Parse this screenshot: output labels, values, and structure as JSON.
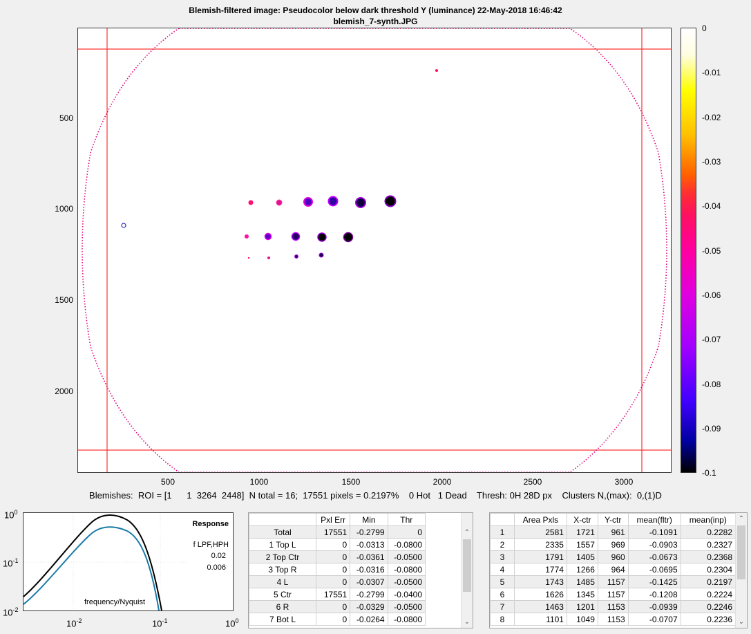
{
  "header": {
    "title_line1": "Blemish-filtered image:  Pseudocolor    below dark threshold    Y (luminance)   22-May-2018 16:46:42",
    "title_line2": "blemish_7-synth.JPG"
  },
  "main_plot": {
    "y_ticks": [
      "500",
      "1000",
      "1500",
      "2000"
    ],
    "x_ticks": [
      "500",
      "1000",
      "1500",
      "2000",
      "2500",
      "3000"
    ]
  },
  "colorbar": {
    "ticks": [
      "0",
      "-0.01",
      "-0.02",
      "-0.03",
      "-0.04",
      "-0.05",
      "-0.06",
      "-0.07",
      "-0.08",
      "-0.09",
      "-0.1"
    ]
  },
  "status_line": "Blemishes:  ROI = [1      1  3264  2448]  N total = 16;  17551 pixels = 0.2197%    0 Hot   1 Dead    Thresh: 0H 28D px    Clusters N,(max):  0,(1)D",
  "response_plot": {
    "y_ticks": [
      "10",
      "10",
      "10"
    ],
    "y_exps": [
      "0",
      "-1",
      "-2"
    ],
    "x_ticks": [
      "10",
      "10",
      "10"
    ],
    "x_exps": [
      "-2",
      "-1",
      "0"
    ],
    "legend_title": "Response",
    "legend_label": "f LPF,HPH",
    "legend_v1": "0.02",
    "legend_v2": "0.006",
    "xlabel": "frequency/Nyquist"
  },
  "region_table": {
    "headers": [
      "",
      "Pxl Err",
      "Min",
      "Thr"
    ],
    "rows": [
      [
        "Total",
        "17551",
        "-0.2799",
        "0"
      ],
      [
        "1 Top L",
        "0",
        "-0.0313",
        "-0.0800"
      ],
      [
        "2 Top Ctr",
        "0",
        "-0.0361",
        "-0.0500"
      ],
      [
        "3 Top R",
        "0",
        "-0.0316",
        "-0.0800"
      ],
      [
        "4 L",
        "0",
        "-0.0307",
        "-0.0500"
      ],
      [
        "5 Ctr",
        "17551",
        "-0.2799",
        "-0.0400"
      ],
      [
        "6 R",
        "0",
        "-0.0329",
        "-0.0500"
      ],
      [
        "7 Bot L",
        "0",
        "-0.0264",
        "-0.0800"
      ]
    ]
  },
  "blemish_table": {
    "headers": [
      "",
      "Area Pxls",
      "X-ctr",
      "Y-ctr",
      "mean(fltr)",
      "mean(inp)"
    ],
    "rows": [
      [
        "1",
        "2581",
        "1721",
        "961",
        "-0.1091",
        "0.2282"
      ],
      [
        "2",
        "2335",
        "1557",
        "969",
        "-0.0903",
        "0.2327"
      ],
      [
        "3",
        "1791",
        "1405",
        "960",
        "-0.0673",
        "0.2368"
      ],
      [
        "4",
        "1774",
        "1266",
        "964",
        "-0.0695",
        "0.2304"
      ],
      [
        "5",
        "1743",
        "1485",
        "1157",
        "-0.1425",
        "0.2197"
      ],
      [
        "6",
        "1626",
        "1345",
        "1157",
        "-0.1208",
        "0.2224"
      ],
      [
        "7",
        "1463",
        "1201",
        "1153",
        "-0.0939",
        "0.2246"
      ],
      [
        "8",
        "1101",
        "1049",
        "1153",
        "-0.0707",
        "0.2236"
      ]
    ]
  }
}
